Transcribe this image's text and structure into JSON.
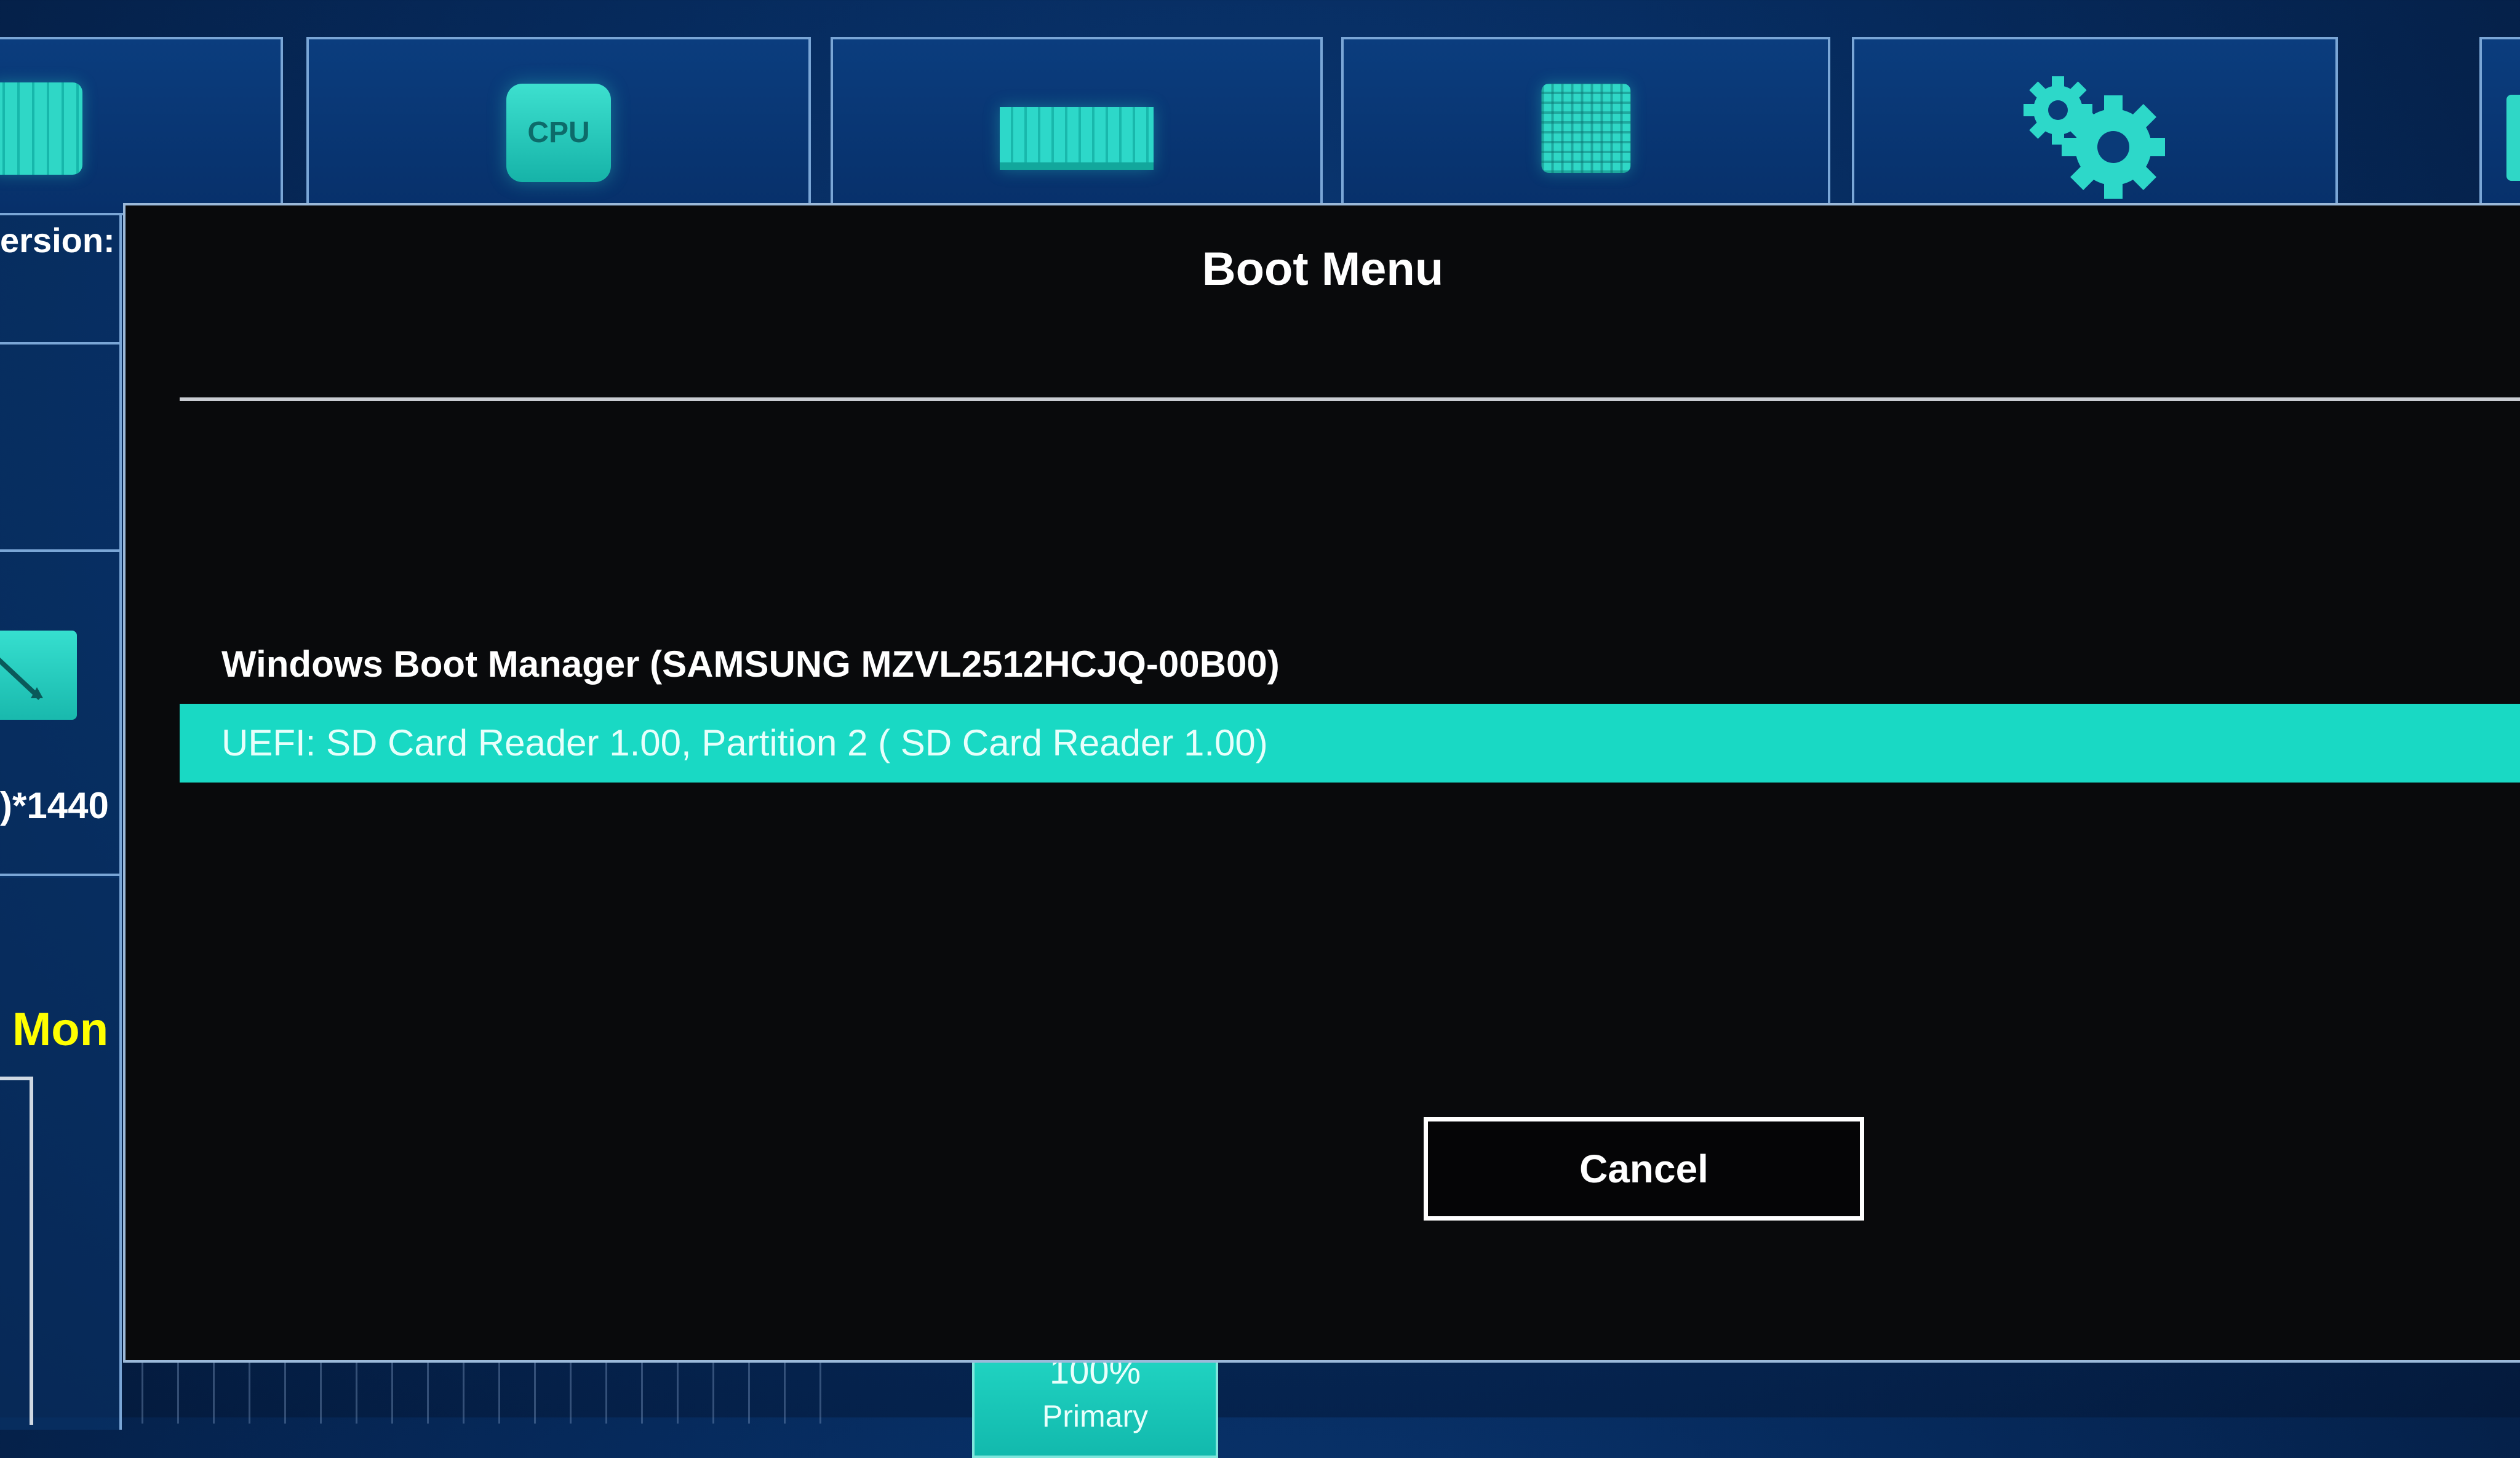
{
  "background": {
    "tiles": [
      {
        "name": "chip",
        "icon": "chip-icon"
      },
      {
        "name": "cpu",
        "label": "CPU",
        "icon": "cpu-icon"
      },
      {
        "name": "memory",
        "icon": "memory-icon"
      },
      {
        "name": "storage",
        "icon": "storage-icon"
      },
      {
        "name": "settings",
        "icon": "gears-icon"
      },
      {
        "name": "partial",
        "icon": "partial-tile-icon"
      }
    ],
    "side_version_label": "ersion:",
    "side_resolution": ")*1440",
    "side_monitor": "Mon",
    "percent_box": {
      "value": "100%",
      "caption": "Primary"
    }
  },
  "colors": {
    "accent": "#19d9c4",
    "monitor_text": "#ffff00",
    "modal_bg": "#090a0c"
  },
  "modal": {
    "title": "Boot Menu",
    "items": [
      {
        "label": "Windows Boot Manager (SAMSUNG MZVL2512HCJQ-00B00)",
        "selected": false
      },
      {
        "label": "UEFI:  SD Card Reader 1.00, Partition 2 ( SD Card Reader 1.00)",
        "selected": true
      }
    ],
    "cancel_label": "Cancel"
  }
}
